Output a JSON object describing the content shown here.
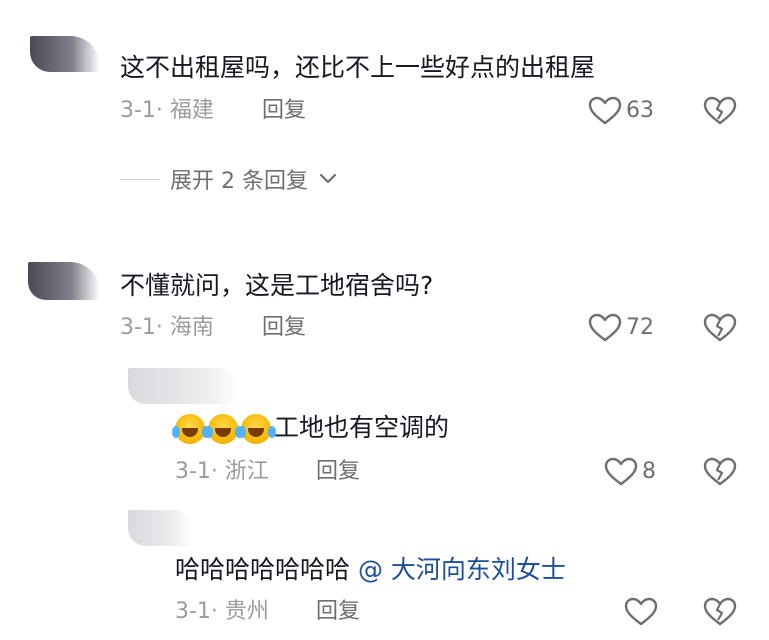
{
  "comments": [
    {
      "text": "这不出租屋吗，还比不上一些好点的出租屋",
      "date_location": "3-1· 福建",
      "reply_label": "回复",
      "likes": "63",
      "expand_label": "展开 2 条回复"
    },
    {
      "text": "不懂就问，这是工地宿舍吗?",
      "date_location": "3-1· 海南",
      "reply_label": "回复",
      "likes": "72"
    }
  ],
  "replies": [
    {
      "text": "工地也有空调的",
      "emoji_count": 3,
      "emoji_name": "laughing-tears-emoji",
      "date_location": "3-1· 浙江",
      "reply_label": "回复",
      "likes": "8"
    },
    {
      "text": "哈哈哈哈哈哈哈",
      "mention": "@ 大河向东刘女士",
      "date_location": "3-1· 贵州",
      "reply_label": "回复",
      "likes": ""
    }
  ],
  "colors": {
    "text": "#161823",
    "meta": "#9a9ba1",
    "action": "#6e6f75",
    "mention": "#1f4f9c"
  },
  "icons": [
    "heart-outline-icon",
    "broken-heart-icon",
    "chevron-down-icon"
  ]
}
